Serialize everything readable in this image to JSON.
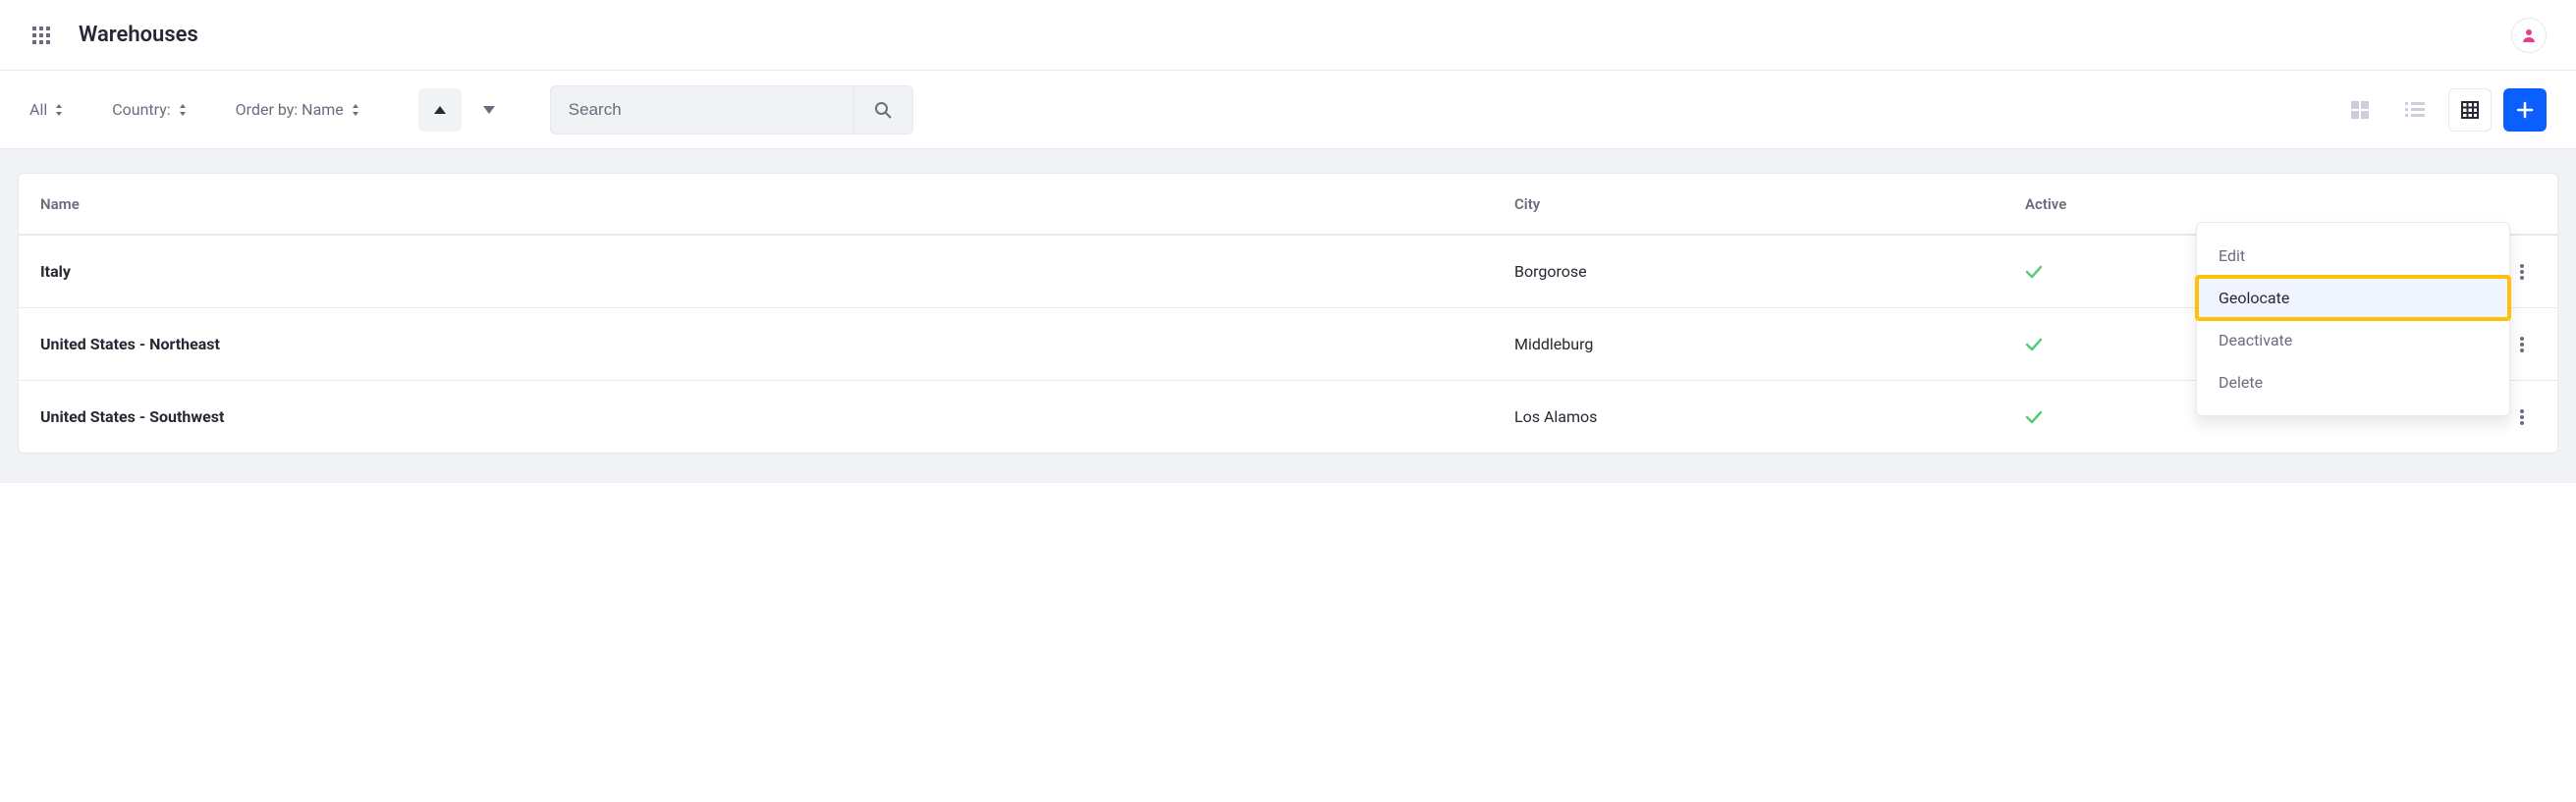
{
  "header": {
    "title": "Warehouses"
  },
  "toolbar": {
    "filter_all": "All",
    "filter_country": "Country:",
    "order_by": "Order by: Name",
    "search_placeholder": "Search"
  },
  "table": {
    "columns": {
      "name": "Name",
      "city": "City",
      "active": "Active"
    },
    "rows": [
      {
        "name": "Italy",
        "city": "Borgorose",
        "active": true
      },
      {
        "name": "United States - Northeast",
        "city": "Middleburg",
        "active": true
      },
      {
        "name": "United States - Southwest",
        "city": "Los Alamos",
        "active": true
      }
    ]
  },
  "dropdown": {
    "edit": "Edit",
    "geolocate": "Geolocate",
    "deactivate": "Deactivate",
    "delete": "Delete"
  }
}
